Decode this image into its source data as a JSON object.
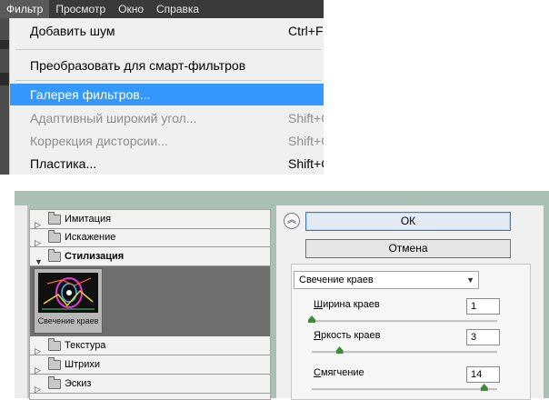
{
  "menubar": {
    "items": [
      {
        "label": "Фильтр",
        "active": true
      },
      {
        "label": "Просмотр",
        "active": false
      },
      {
        "label": "Окно",
        "active": false
      },
      {
        "label": "Справка",
        "active": false
      }
    ]
  },
  "filter_menu": {
    "add_noise": {
      "label": "Добавить шум",
      "shortcut": "Ctrl+F"
    },
    "convert_smart": {
      "label": "Преобразовать для смарт-фильтров"
    },
    "gallery": {
      "label": "Галерея фильтров..."
    },
    "adaptive_wide": {
      "label": "Адаптивный широкий угол...",
      "shortcut": "Shift+Ctrl+A"
    },
    "lens_correction": {
      "label": "Коррекция дисторсии...",
      "shortcut": "Shift+Ctrl+R"
    },
    "liquify": {
      "label": "Пластика...",
      "shortcut": "Shift+Ctrl+X"
    }
  },
  "gallery_tree": {
    "folders": [
      {
        "label": "Имитация"
      },
      {
        "label": "Искажение"
      },
      {
        "label": "Стилизация"
      },
      {
        "label": "Текстура"
      },
      {
        "label": "Штрихи"
      },
      {
        "label": "Эскиз"
      }
    ],
    "thumbnail": {
      "caption": "Свечение краев",
      "selected": true
    }
  },
  "buttons": {
    "ok": "ОК",
    "cancel": "Отмена"
  },
  "settings": {
    "filter_select": "Свечение краев",
    "params": [
      {
        "label_first": "Ш",
        "label_rest": "ирина краев",
        "value": "1",
        "level": 0.0
      },
      {
        "label_first": "Я",
        "label_rest": "ркость краев",
        "value": "3",
        "level": 0.15
      },
      {
        "label_first": "С",
        "label_rest": "мягчение",
        "value": "14",
        "level": 0.93
      }
    ]
  },
  "colors": {
    "highlight": "#3399ff",
    "menubar": "#3a3a3a",
    "gallery_frame": "#aac0b7",
    "slider_knob": "#3f8a3f"
  },
  "icons": [
    "folder-icon",
    "disclosure-triangle-icon",
    "collapse-chevron-icon",
    "dropdown-arrow-icon"
  ]
}
